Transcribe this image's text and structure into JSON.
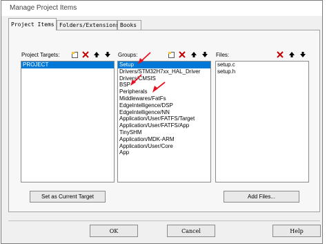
{
  "window": {
    "title": "Manage Project Items"
  },
  "tabs": [
    {
      "label": "Project Items"
    },
    {
      "label": "Folders/Extensions"
    },
    {
      "label": "Books"
    }
  ],
  "targets": {
    "header": "Project Targets:",
    "items": [
      "PROJECT"
    ],
    "selected_index": 0
  },
  "groups": {
    "header": "Groups:",
    "items": [
      "Setup",
      "Drivers/STM32H7xx_HAL_Driver",
      "Drivers/CMSIS",
      "BSP",
      "Peripherals",
      "Middlewares/FatFs",
      "EdgeIntelligence/DSP",
      "EdgeIntelligence/NN",
      "Application/User/FATFS/Target",
      "Application/User/FATFS/App",
      "TinySHM",
      "Application/MDK-ARM",
      "Application/User/Core",
      "App"
    ],
    "selected_index": 0
  },
  "files": {
    "header": "Files:",
    "items": [
      "setup.c",
      "setup.h"
    ]
  },
  "buttons": {
    "set_current_target": "Set as Current Target",
    "add_files": "Add Files...",
    "ok": "OK",
    "cancel": "Cancel",
    "help": "Help"
  },
  "colors": {
    "selection": "#0078d7",
    "delete_icon": "#c00000",
    "arrow_annotation": "#e81123"
  }
}
